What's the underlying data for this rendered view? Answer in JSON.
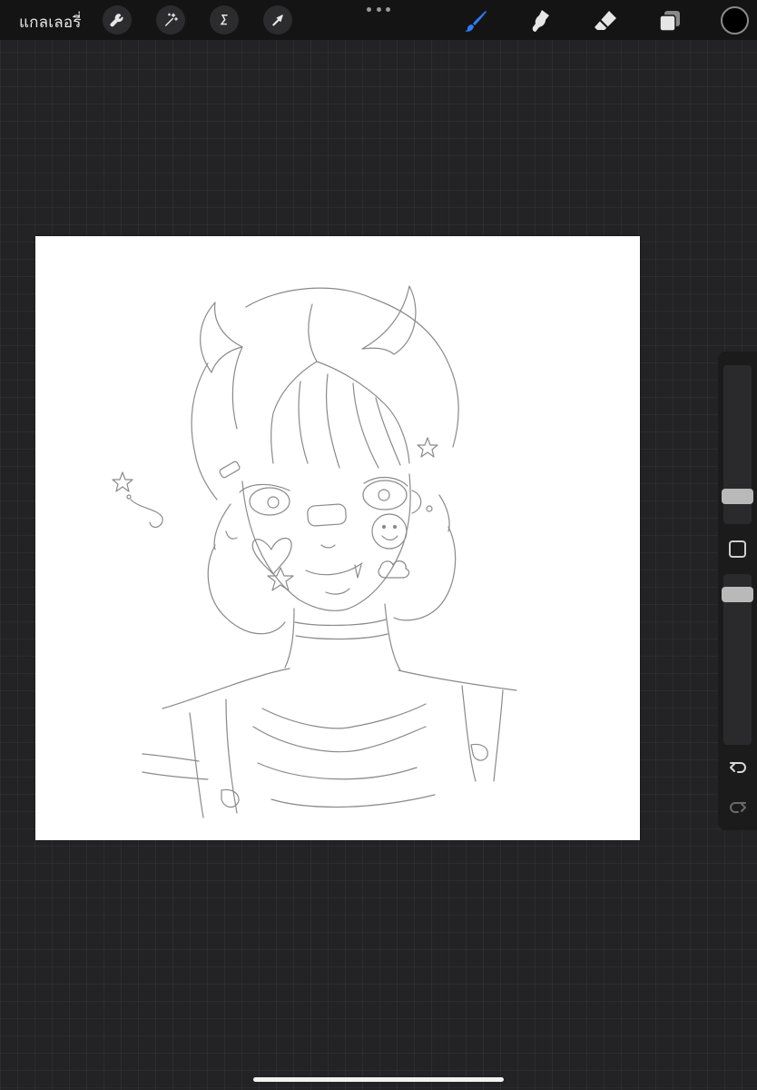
{
  "topbar": {
    "gallery_label": "แกลเลอรี่",
    "tools_left": [
      "wrench-icon",
      "magic-wand-icon",
      "selection-s-icon",
      "transform-arrow-icon"
    ],
    "more_menu": "more-dots-icon",
    "tools_right": [
      "brush-icon",
      "smudge-icon",
      "eraser-icon",
      "layers-icon"
    ],
    "active_tool": "brush",
    "active_tool_color": "#2f7cf6",
    "current_color": "#000000"
  },
  "sidebar": {
    "brush_size": "size-slider",
    "modify_button": "modify-square-icon",
    "opacity": "opacity-slider",
    "undo": "undo-arrow-icon",
    "redo": "redo-arrow-icon"
  },
  "canvas": {
    "background": "#ffffff",
    "content": "pencil-sketch"
  }
}
